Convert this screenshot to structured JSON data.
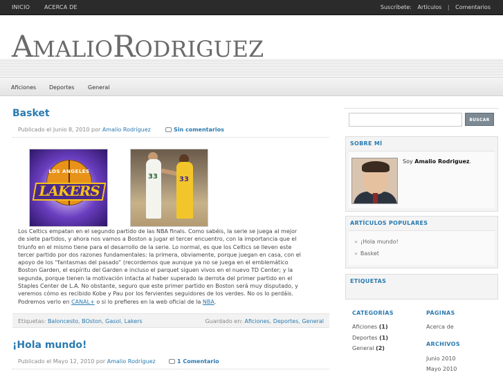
{
  "topbar": {
    "nav": [
      "INICIO",
      "ACERCA DE"
    ],
    "subscribe_label": "Suscríbete:",
    "subscribe_articles": "Artículos",
    "subscribe_sep": "|",
    "subscribe_comments": "Comentarios"
  },
  "header": {
    "logo_a": "A",
    "logo_malio": "MALIO",
    "logo_r": "R",
    "logo_odriguez": "ODRIGUEZ"
  },
  "categories_bar": [
    "Aficiones",
    "Deportes",
    "General"
  ],
  "posts": [
    {
      "title": "Basket",
      "meta_prefix": "Publicado el Junio 8, 2010 por",
      "author": "Amalio Rodríguez",
      "comments": "Sin comentarios",
      "image1_alt_text": "LOS ANGELES",
      "image1_wordmark": "LAKERS",
      "image2_num1": "33",
      "image2_num2": "33",
      "body_lines": [
        "Los Celtics empatan en el segundo partido de las NBA finals. Como sabéis, la serie se juega al mejor",
        "de siete partidos, y ahora nos vamos a Boston a jugar el tercer encuentro, con la importancia que el",
        "triunfo en el mismo tiene para el desarrollo de la serie. Lo normal, es que los Celtics se lleven este",
        "tercer partido por dos razones fundamentales: la primera, obviamente, porque juegan en casa, con el",
        "apoyo de los “fantasmas del pasado” (recordemos que aunque ya no se juega en el emblemático",
        "Boston Garden, el espíritu del Garden e incluso el parquet siguen vivos en el nuevo TD Center; y la",
        "segunda, porque tienen la motivación intacta al haber superado la derrota del primer partido en el",
        "Staples Center de L.A. No obstante, seguro que este primer partido en Boston será muy disputado, y",
        "veremos cómo es recibido Kobe y Pau por los fervientes seguidores de los verdes. No os lo perdáis."
      ],
      "body_last_prefix": "Podremos verlo en",
      "body_link1": "CANAL+",
      "body_last_mid": "o si lo prefieres en la web oficial de la",
      "body_link2": "NBA",
      "body_last_suffix": ".",
      "tags_label": "Etiquetas:",
      "tags": [
        "Baloncesto",
        "BOston",
        "Gasol",
        "Lakers"
      ],
      "filed_label": "Guardado en:",
      "filed": [
        "Aficiones",
        "Deportes",
        "General"
      ]
    },
    {
      "title": "¡Hola mundo!",
      "meta_prefix": "Publicado el Mayo 12, 2010 por",
      "author": "Amalio Rodríguez",
      "comments": "1 Comentario"
    }
  ],
  "sidebar": {
    "search_button": "BUSCAR",
    "search_value": "",
    "about_title": "SOBRE MÍ",
    "about_prefix": "Soy",
    "about_name": "Amalio Rodriguez",
    "about_suffix": ".",
    "popular_title": "ARTÍCULOS POPULARES",
    "popular_items": [
      "¡Hola mundo!",
      "Basket"
    ],
    "tags_title": "ETIQUETAS",
    "categories_title": "CATEGORÍAS",
    "categories": [
      {
        "name": "Aficiones",
        "count": "(1)"
      },
      {
        "name": "Deportes",
        "count": "(1)"
      },
      {
        "name": "General",
        "count": "(2)"
      }
    ],
    "pages_title": "PÁGINAS",
    "pages": [
      "Acerca de"
    ],
    "archives_title": "ARCHIVOS",
    "archives": [
      "Junio 2010",
      "Mayo 2010"
    ]
  },
  "colors": {
    "accent": "#2a7ab0",
    "topbar": "#2b2b2b"
  }
}
